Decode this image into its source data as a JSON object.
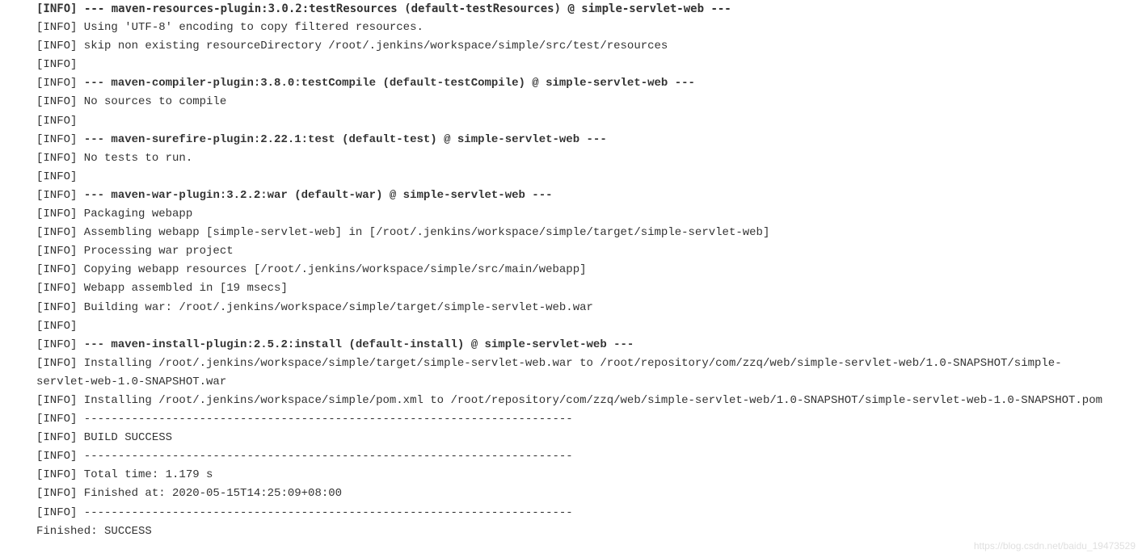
{
  "log": {
    "l00": "[INFO] --- maven-resources-plugin:3.0.2:testResources (default-testResources) @ simple-servlet-web ---",
    "l01": "[INFO] Using 'UTF-8' encoding to copy filtered resources.",
    "l02": "[INFO] skip non existing resourceDirectory /root/.jenkins/workspace/simple/src/test/resources",
    "l03": "[INFO] ",
    "l04p": "[INFO] ",
    "l04g": "--- maven-compiler-plugin:3.8.0:testCompile (default-testCompile) @ simple-servlet-web ---",
    "l05": "[INFO] No sources to compile",
    "l06": "[INFO] ",
    "l07p": "[INFO] ",
    "l07g": "--- maven-surefire-plugin:2.22.1:test (default-test) @ simple-servlet-web ---",
    "l08": "[INFO] No tests to run.",
    "l09": "[INFO] ",
    "l10p": "[INFO] ",
    "l10g": "--- maven-war-plugin:3.2.2:war (default-war) @ simple-servlet-web ---",
    "l11": "[INFO] Packaging webapp",
    "l12": "[INFO] Assembling webapp [simple-servlet-web] in [/root/.jenkins/workspace/simple/target/simple-servlet-web]",
    "l13": "[INFO] Processing war project",
    "l14": "[INFO] Copying webapp resources [/root/.jenkins/workspace/simple/src/main/webapp]",
    "l15": "[INFO] Webapp assembled in [19 msecs]",
    "l16": "[INFO] Building war: /root/.jenkins/workspace/simple/target/simple-servlet-web.war",
    "l17": "[INFO] ",
    "l18p": "[INFO] ",
    "l18g": "--- maven-install-plugin:2.5.2:install (default-install) @ simple-servlet-web ---",
    "l19": "[INFO] Installing /root/.jenkins/workspace/simple/target/simple-servlet-web.war to /root/repository/com/zzq/web/simple-servlet-web/1.0-SNAPSHOT/simple-servlet-web-1.0-SNAPSHOT.war",
    "l20": "[INFO] Installing /root/.jenkins/workspace/simple/pom.xml to /root/repository/com/zzq/web/simple-servlet-web/1.0-SNAPSHOT/simple-servlet-web-1.0-SNAPSHOT.pom",
    "l21": "[INFO] ------------------------------------------------------------------------",
    "l22": "[INFO] BUILD SUCCESS",
    "l23": "[INFO] ------------------------------------------------------------------------",
    "l24": "[INFO] Total time:  1.179 s",
    "l25": "[INFO] Finished at: 2020-05-15T14:25:09+08:00",
    "l26": "[INFO] ------------------------------------------------------------------------",
    "l27": "Finished: SUCCESS"
  },
  "watermark": "https://blog.csdn.net/baidu_19473529"
}
